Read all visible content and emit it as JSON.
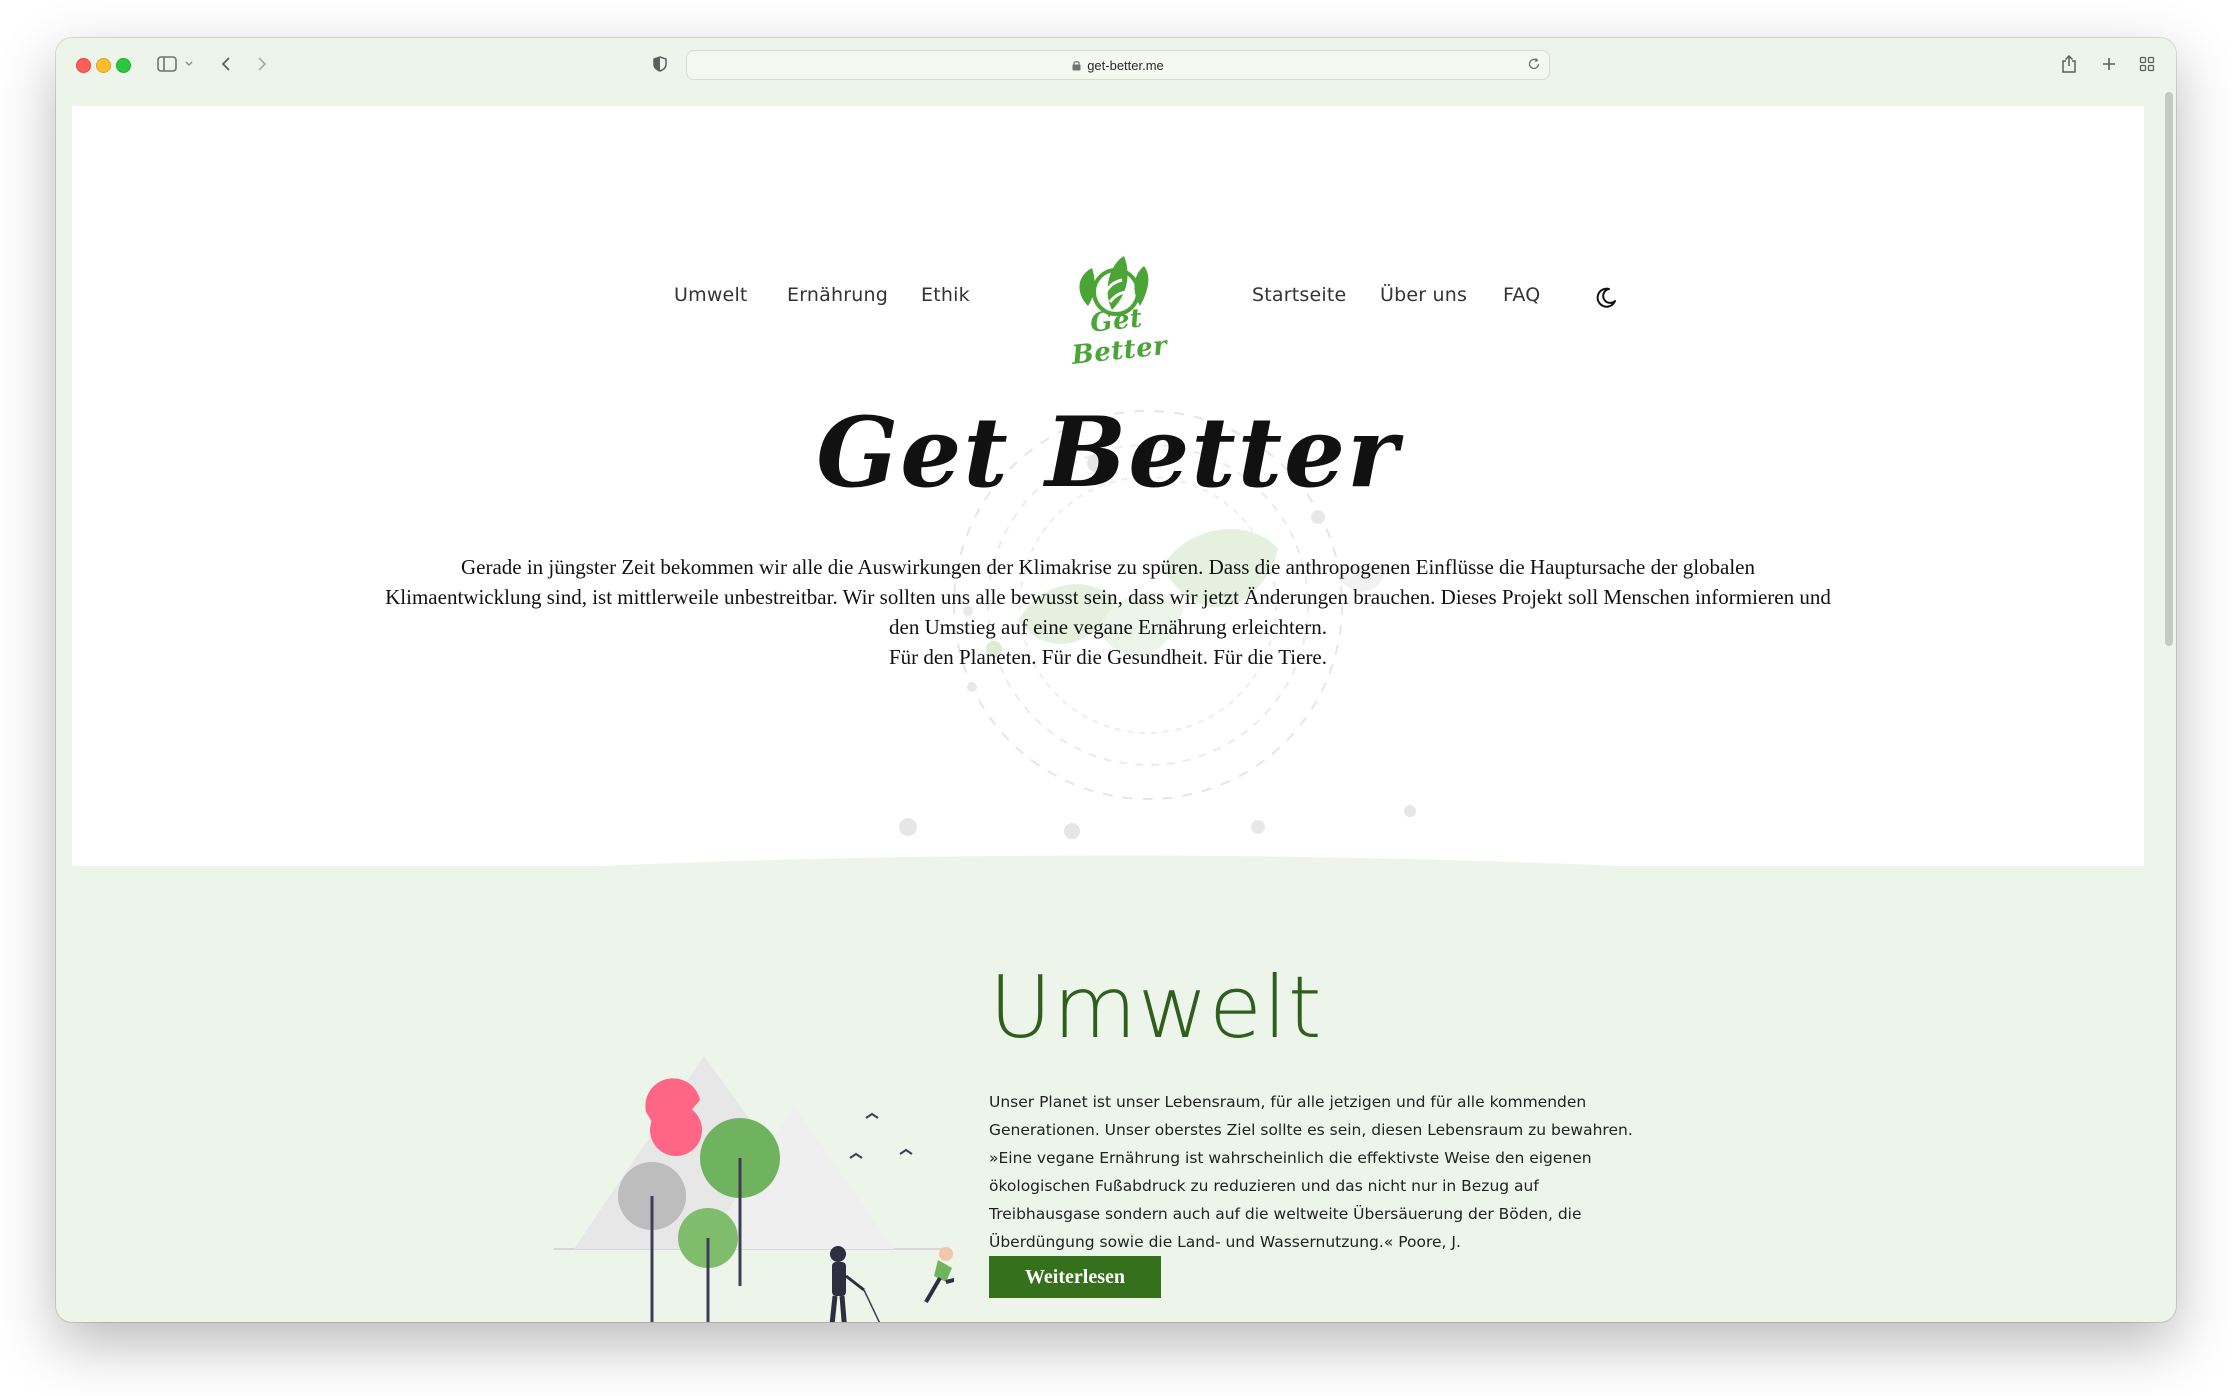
{
  "browser": {
    "url": "get-better.me"
  },
  "nav": {
    "left_links": [
      "Umwelt",
      "Ernährung",
      "Ethik"
    ],
    "logo_text": "Get Better",
    "right_links": [
      "Startseite",
      "Über uns",
      "FAQ"
    ],
    "theme_toggle_icon": "moon-icon"
  },
  "hero": {
    "title": "Get Better",
    "paragraph": "Gerade in jüngster Zeit bekommen wir alle die Auswirkungen der Klimakrise zu spüren. Dass die anthropogenen Einflüsse die Hauptursache der globalen Klimaentwicklung sind, ist mittlerweile unbestreitbar. Wir sollten uns alle bewusst sein, dass wir jetzt Änderungen brauchen. Dieses Projekt soll Menschen informieren und den Umstieg auf eine vegane Ernährung erleichtern.",
    "tagline": "Für den Planeten. Für die Gesundheit. Für die Tiere."
  },
  "section_umwelt": {
    "title": "Umwelt",
    "text": "Unser Planet ist unser Lebensraum, für alle jetzigen und für alle kommenden Generationen. Unser oberstes Ziel sollte es sein, diesen Lebensraum zu bewahren. »Eine vegane Ernährung ist wahrscheinlich die effektivste Weise den eigenen ökologischen Fußabdruck zu reduzieren und das nicht nur in Bezug auf Treibhausgase sondern auch auf die weltweite Übersäuerung der Böden, die Überdüngung sowie die Land- und Wassernutzung.« Poore, J.",
    "button_label": "Weiterlesen"
  },
  "colors": {
    "accent_green": "#35701d",
    "logo_green": "#4aa536",
    "section_bg": "#edf4e9",
    "heading_green": "#2f5f1f"
  }
}
